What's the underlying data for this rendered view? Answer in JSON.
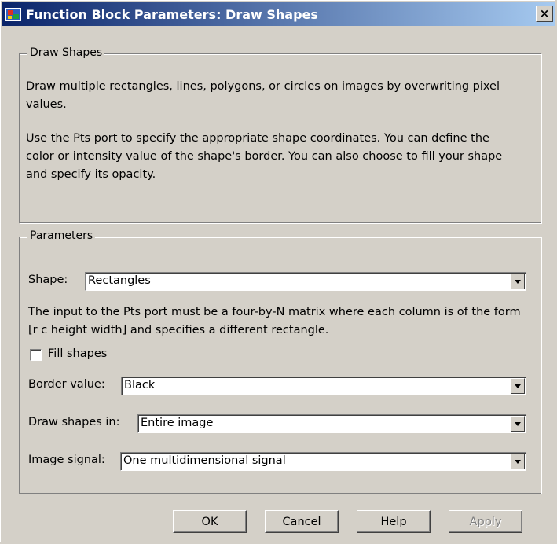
{
  "window": {
    "title": "Function Block Parameters: Draw Shapes",
    "close_glyph": "×"
  },
  "description_group": {
    "title": "Draw Shapes",
    "line1a": "Draw multiple rectangles, lines, polygons, or circles on images by overwriting pixel",
    "line1b": "values.",
    "line2a": "Use the Pts port to specify the appropriate shape coordinates. You can define the",
    "line2b": "color or intensity value of the shape's border. You can also choose to fill your shape",
    "line2c": "and specify its opacity."
  },
  "parameters_group": {
    "title": "Parameters",
    "shape_label": "Shape:",
    "shape_value": "Rectangles",
    "help_line1": "The input to the Pts port must be a four-by-N matrix where each column is of the form",
    "help_line2": "[r c height width] and specifies a different rectangle.",
    "fill_label": "Fill shapes",
    "fill_checked": false,
    "border_label": "Border value:",
    "border_value": "Black",
    "draw_in_label": "Draw shapes in:",
    "draw_in_value": "Entire image",
    "image_signal_label": "Image signal:",
    "image_signal_value": "One multidimensional signal"
  },
  "buttons": {
    "ok": "OK",
    "cancel": "Cancel",
    "help": "Help",
    "apply": "Apply"
  },
  "colors": {
    "titlebar_start": "#0a246a",
    "titlebar_end": "#a6caf0",
    "face": "#d4d0c8"
  },
  "icons": {
    "title": "simulink-block-icon",
    "close": "close-icon",
    "dropdown": "chevron-down-icon"
  }
}
